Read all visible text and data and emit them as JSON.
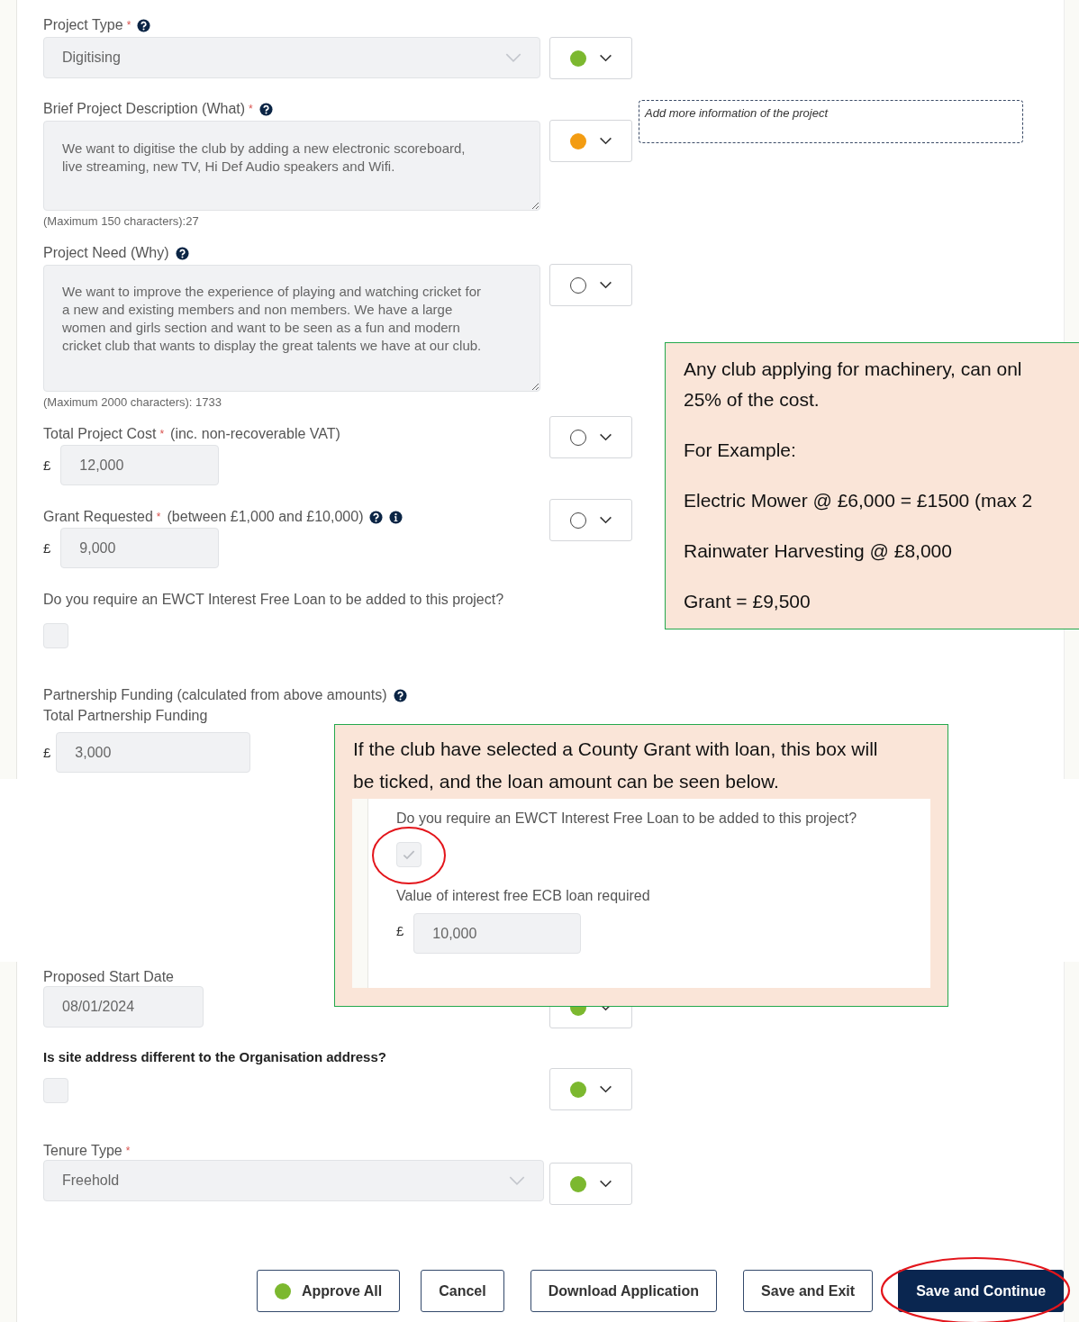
{
  "required_mark": "*",
  "sections": [
    {
      "fields": [
        {
          "kind": "select",
          "label": "Project Type",
          "required": true,
          "help": true,
          "value": "Digitising",
          "status": {
            "filled": true,
            "color": "#7cb82f"
          }
        },
        {
          "kind": "textarea",
          "label": "Brief Project Description (What)",
          "required": true,
          "help": true,
          "value": "We want to digitise the club by adding a new electronic scoreboard, live streaming, new TV, Hi Def Audio speakers and Wifi.",
          "counter": "(Maximum 150 characters):27",
          "status": {
            "filled": true,
            "color": "#f39c12"
          },
          "note": {
            "placeholder": "Add more information of the project"
          }
        },
        {
          "kind": "textarea",
          "label": "Project Need (Why)",
          "help": true,
          "value": "We want to improve the experience of playing and watching cricket for a new and existing members and non members. We have a large women and girls section and want to be seen as a fun and modern cricket club that wants to display the great talents we have at our club.",
          "counter": "(Maximum 2000 characters): 1733",
          "status": {
            "filled": false
          }
        },
        {
          "kind": "currency",
          "label": "Total Project Cost",
          "required": true,
          "hint": "(inc. non-recoverable VAT)",
          "currency": "£",
          "value": "12,000",
          "status": {
            "filled": false
          }
        },
        {
          "kind": "currency",
          "label": "Grant Requested",
          "required": true,
          "hint": "(between £1,000 and £10,000)",
          "help": true,
          "info": true,
          "currency": "£",
          "value": "9,000",
          "status": {
            "filled": false
          }
        },
        {
          "kind": "checkbox",
          "label": "Do you require an EWCT Interest Free Loan to be added to this project?",
          "checked": false
        },
        {
          "kind": "currency",
          "label": "Partnership Funding (calculated from above amounts)",
          "help": true,
          "sublabel": "Total Partnership Funding",
          "currency": "£",
          "value": "3,000"
        }
      ]
    },
    {
      "fields": [
        {
          "kind": "date",
          "label": "Proposed Start Date",
          "value": "08/01/2024",
          "status": {
            "filled": true,
            "color": "#7cb82f"
          }
        },
        {
          "kind": "checkbox",
          "label": "Is site address different to the Organisation address?",
          "bold": true,
          "checked": false,
          "status": {
            "filled": true,
            "color": "#7cb82f"
          }
        },
        {
          "kind": "select",
          "label": "Tenure Type",
          "required": true,
          "value": "Freehold",
          "status": {
            "filled": true,
            "color": "#7cb82f"
          }
        }
      ]
    }
  ],
  "buttons": [
    {
      "label": "Approve All",
      "kind": "outline",
      "color": "#7cb82f",
      "circled": false
    },
    {
      "label": "Cancel",
      "kind": "outline",
      "circled": false
    },
    {
      "label": "Download Application",
      "kind": "outline",
      "circled": false
    },
    {
      "label": "Save and Exit",
      "kind": "outline",
      "circled": false
    },
    {
      "label": "Save and Continue",
      "kind": "primary",
      "circled": true
    }
  ],
  "callouts": [
    {
      "kind": "lines",
      "paragraphs": [
        [
          "Any club applying for machinery, can onl",
          "25% of the cost."
        ],
        [
          "For Example:"
        ],
        [
          "Electric Mower @ £6,000 = £1500 (max 2"
        ],
        [
          "Rainwater Harvesting @ £8,000"
        ],
        [
          "Grant = £9,500"
        ]
      ]
    },
    {
      "kind": "panel",
      "text": "If the club have selected a County Grant with loan, this box will be ticked, and the loan amount can be seen below.",
      "fields": [
        {
          "kind": "checkbox",
          "label": "Do you require an EWCT Interest Free Loan to be added to this project?",
          "checked": true,
          "circled": true
        },
        {
          "kind": "currency",
          "label": "Value of interest free ECB loan required",
          "currency": "£",
          "value": "10,000"
        }
      ]
    }
  ]
}
